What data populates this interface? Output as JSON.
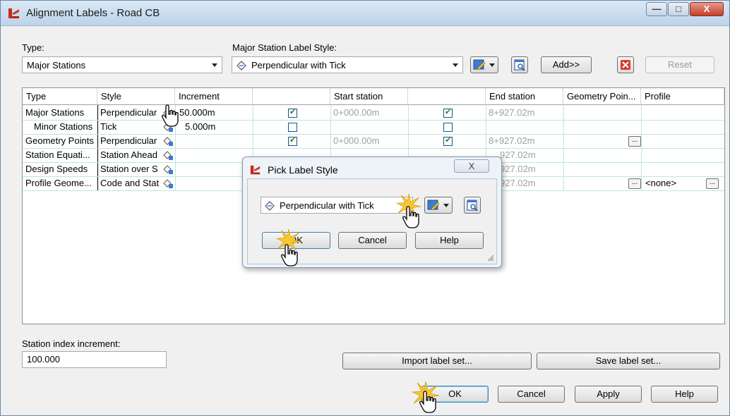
{
  "window": {
    "title": "Alignment Labels - Road CB",
    "controls": {
      "minimize": "—",
      "maximize": "□",
      "close": "X"
    }
  },
  "type_label": "Type:",
  "type_value": "Major Stations",
  "style_label": "Major Station Label Style:",
  "style_value": "Perpendicular with Tick",
  "add_button": "Add>>",
  "delete_icon": "delete-icon",
  "reset_button": "Reset",
  "grid": {
    "headers": [
      "Type",
      "Style",
      "Increment",
      "",
      "Start station",
      "",
      "End station",
      "Geometry Poin...",
      "Profile"
    ],
    "rows": [
      {
        "type": "Major Stations",
        "style": "Perpendicular",
        "increment": "50.000m",
        "start_checked": true,
        "start": "0+000.00m",
        "end_checked": true,
        "end": "8+927.02m",
        "geometry": "",
        "profile": ""
      },
      {
        "type": "Minor Stations",
        "style": "Tick",
        "increment": "5.000m",
        "start_checked": false,
        "start": "",
        "end_checked": false,
        "end": "",
        "geometry": "",
        "profile": ""
      },
      {
        "type": "Geometry Points",
        "style": "Perpendicular",
        "increment": "",
        "start_checked": true,
        "start": "0+000.00m",
        "end_checked": true,
        "end": "8+927.02m",
        "geometry": "...",
        "profile": ""
      },
      {
        "type": "Station Equati...",
        "style": "Station Ahead",
        "increment": "",
        "start_checked": null,
        "start": "",
        "end_checked": null,
        "end": "927.02m",
        "geometry": "",
        "profile": ""
      },
      {
        "type": "Design Speeds",
        "style": "Station over S",
        "increment": "",
        "start_checked": null,
        "start": "",
        "end_checked": null,
        "end": "927.02m",
        "geometry": "",
        "profile": ""
      },
      {
        "type": "Profile Geome...",
        "style": "Code and Stat",
        "increment": "",
        "start_checked": null,
        "start": "",
        "end_checked": null,
        "end": "927.02m",
        "geometry": "...",
        "profile": "<none>"
      }
    ]
  },
  "station_index_label": "Station index increment:",
  "station_index_value": "100.000",
  "import_button": "Import label set...",
  "save_button": "Save label set...",
  "ok_button": "OK",
  "cancel_button": "Cancel",
  "apply_button": "Apply",
  "help_button": "Help",
  "pick_dialog": {
    "title": "Pick Label Style",
    "close": "X",
    "style_value": "Perpendicular with Tick",
    "ok_button": "OK",
    "cancel_button": "Cancel",
    "help_button": "Help"
  }
}
